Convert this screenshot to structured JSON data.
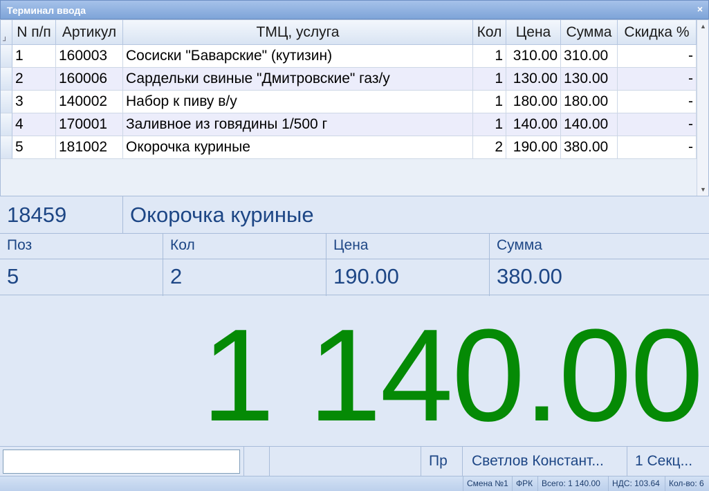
{
  "window": {
    "title": "Терминал ввода",
    "close_glyph": "×"
  },
  "grid": {
    "columns": [
      "N п/п",
      "Артикул",
      "ТМЦ, услуга",
      "Кол",
      "Цена",
      "Сумма",
      "Скидка %"
    ],
    "rows": [
      {
        "n": "1",
        "article": "160003",
        "name": "Сосиски \"Баварские\" (кутизин)",
        "qty": "1",
        "price": "310.00",
        "sum": "310.00",
        "discount": "-"
      },
      {
        "n": "2",
        "article": "160006",
        "name": "Сардельки свиные \"Дмитровские\" газ/у",
        "qty": "1",
        "price": "130.00",
        "sum": "130.00",
        "discount": "-"
      },
      {
        "n": "3",
        "article": "140002",
        "name": "Набор к пиву в/у",
        "qty": "1",
        "price": "180.00",
        "sum": "180.00",
        "discount": "-"
      },
      {
        "n": "4",
        "article": "170001",
        "name": "Заливное из говядины 1/500 г",
        "qty": "1",
        "price": "140.00",
        "sum": "140.00",
        "discount": "-"
      },
      {
        "n": "5",
        "article": "181002",
        "name": "Окорочка куриные",
        "qty": "2",
        "price": "190.00",
        "sum": "380.00",
        "discount": "-"
      }
    ]
  },
  "current": {
    "code": "18459",
    "name": "Окорочка куриные",
    "pos_label": "Поз",
    "pos": "5",
    "qty_label": "Кол",
    "qty": "2",
    "price_label": "Цена",
    "price": "190.00",
    "sum_label": "Сумма",
    "sum": "380.00"
  },
  "total": "1 140.00",
  "input": {
    "value": "",
    "placeholder": ""
  },
  "bottom": {
    "mode": "Пр",
    "cashier": "Светлов Констант...",
    "section": "1 Секц..."
  },
  "status": {
    "shift": "Смена №1",
    "fiscal": "ФРК",
    "total": "Всего: 1 140.00",
    "vat": "НДС: 103.64",
    "count": "Кол-во: 6"
  },
  "colors": {
    "total": "#058a05",
    "accent": "#1d4685",
    "titlebar": "#7ea4d8"
  }
}
